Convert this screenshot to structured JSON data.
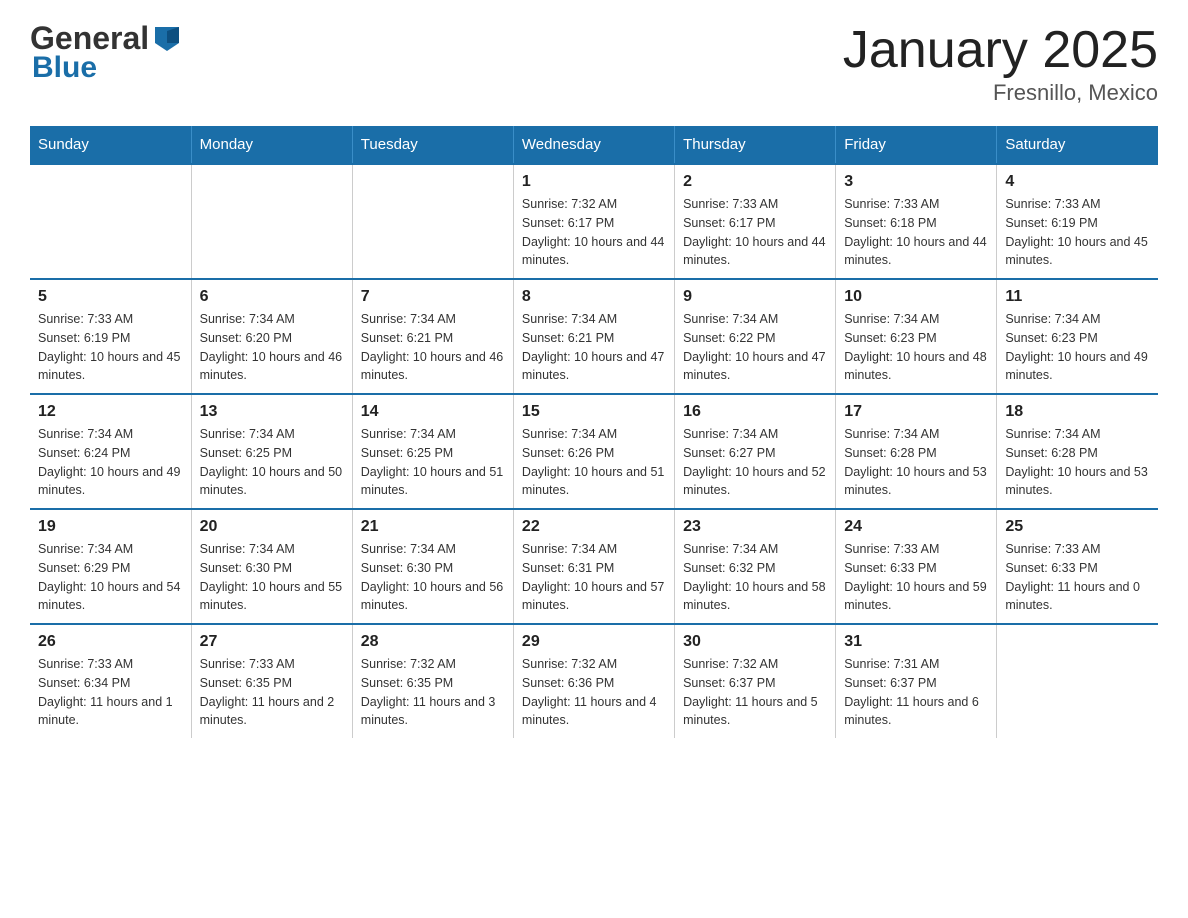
{
  "header": {
    "logo_general": "General",
    "logo_blue": "Blue",
    "title": "January 2025",
    "subtitle": "Fresnillo, Mexico"
  },
  "days_of_week": [
    "Sunday",
    "Monday",
    "Tuesday",
    "Wednesday",
    "Thursday",
    "Friday",
    "Saturday"
  ],
  "weeks": [
    {
      "days": [
        {
          "num": "",
          "info": ""
        },
        {
          "num": "",
          "info": ""
        },
        {
          "num": "",
          "info": ""
        },
        {
          "num": "1",
          "info": "Sunrise: 7:32 AM\nSunset: 6:17 PM\nDaylight: 10 hours and 44 minutes."
        },
        {
          "num": "2",
          "info": "Sunrise: 7:33 AM\nSunset: 6:17 PM\nDaylight: 10 hours and 44 minutes."
        },
        {
          "num": "3",
          "info": "Sunrise: 7:33 AM\nSunset: 6:18 PM\nDaylight: 10 hours and 44 minutes."
        },
        {
          "num": "4",
          "info": "Sunrise: 7:33 AM\nSunset: 6:19 PM\nDaylight: 10 hours and 45 minutes."
        }
      ]
    },
    {
      "days": [
        {
          "num": "5",
          "info": "Sunrise: 7:33 AM\nSunset: 6:19 PM\nDaylight: 10 hours and 45 minutes."
        },
        {
          "num": "6",
          "info": "Sunrise: 7:34 AM\nSunset: 6:20 PM\nDaylight: 10 hours and 46 minutes."
        },
        {
          "num": "7",
          "info": "Sunrise: 7:34 AM\nSunset: 6:21 PM\nDaylight: 10 hours and 46 minutes."
        },
        {
          "num": "8",
          "info": "Sunrise: 7:34 AM\nSunset: 6:21 PM\nDaylight: 10 hours and 47 minutes."
        },
        {
          "num": "9",
          "info": "Sunrise: 7:34 AM\nSunset: 6:22 PM\nDaylight: 10 hours and 47 minutes."
        },
        {
          "num": "10",
          "info": "Sunrise: 7:34 AM\nSunset: 6:23 PM\nDaylight: 10 hours and 48 minutes."
        },
        {
          "num": "11",
          "info": "Sunrise: 7:34 AM\nSunset: 6:23 PM\nDaylight: 10 hours and 49 minutes."
        }
      ]
    },
    {
      "days": [
        {
          "num": "12",
          "info": "Sunrise: 7:34 AM\nSunset: 6:24 PM\nDaylight: 10 hours and 49 minutes."
        },
        {
          "num": "13",
          "info": "Sunrise: 7:34 AM\nSunset: 6:25 PM\nDaylight: 10 hours and 50 minutes."
        },
        {
          "num": "14",
          "info": "Sunrise: 7:34 AM\nSunset: 6:25 PM\nDaylight: 10 hours and 51 minutes."
        },
        {
          "num": "15",
          "info": "Sunrise: 7:34 AM\nSunset: 6:26 PM\nDaylight: 10 hours and 51 minutes."
        },
        {
          "num": "16",
          "info": "Sunrise: 7:34 AM\nSunset: 6:27 PM\nDaylight: 10 hours and 52 minutes."
        },
        {
          "num": "17",
          "info": "Sunrise: 7:34 AM\nSunset: 6:28 PM\nDaylight: 10 hours and 53 minutes."
        },
        {
          "num": "18",
          "info": "Sunrise: 7:34 AM\nSunset: 6:28 PM\nDaylight: 10 hours and 53 minutes."
        }
      ]
    },
    {
      "days": [
        {
          "num": "19",
          "info": "Sunrise: 7:34 AM\nSunset: 6:29 PM\nDaylight: 10 hours and 54 minutes."
        },
        {
          "num": "20",
          "info": "Sunrise: 7:34 AM\nSunset: 6:30 PM\nDaylight: 10 hours and 55 minutes."
        },
        {
          "num": "21",
          "info": "Sunrise: 7:34 AM\nSunset: 6:30 PM\nDaylight: 10 hours and 56 minutes."
        },
        {
          "num": "22",
          "info": "Sunrise: 7:34 AM\nSunset: 6:31 PM\nDaylight: 10 hours and 57 minutes."
        },
        {
          "num": "23",
          "info": "Sunrise: 7:34 AM\nSunset: 6:32 PM\nDaylight: 10 hours and 58 minutes."
        },
        {
          "num": "24",
          "info": "Sunrise: 7:33 AM\nSunset: 6:33 PM\nDaylight: 10 hours and 59 minutes."
        },
        {
          "num": "25",
          "info": "Sunrise: 7:33 AM\nSunset: 6:33 PM\nDaylight: 11 hours and 0 minutes."
        }
      ]
    },
    {
      "days": [
        {
          "num": "26",
          "info": "Sunrise: 7:33 AM\nSunset: 6:34 PM\nDaylight: 11 hours and 1 minute."
        },
        {
          "num": "27",
          "info": "Sunrise: 7:33 AM\nSunset: 6:35 PM\nDaylight: 11 hours and 2 minutes."
        },
        {
          "num": "28",
          "info": "Sunrise: 7:32 AM\nSunset: 6:35 PM\nDaylight: 11 hours and 3 minutes."
        },
        {
          "num": "29",
          "info": "Sunrise: 7:32 AM\nSunset: 6:36 PM\nDaylight: 11 hours and 4 minutes."
        },
        {
          "num": "30",
          "info": "Sunrise: 7:32 AM\nSunset: 6:37 PM\nDaylight: 11 hours and 5 minutes."
        },
        {
          "num": "31",
          "info": "Sunrise: 7:31 AM\nSunset: 6:37 PM\nDaylight: 11 hours and 6 minutes."
        },
        {
          "num": "",
          "info": ""
        }
      ]
    }
  ]
}
